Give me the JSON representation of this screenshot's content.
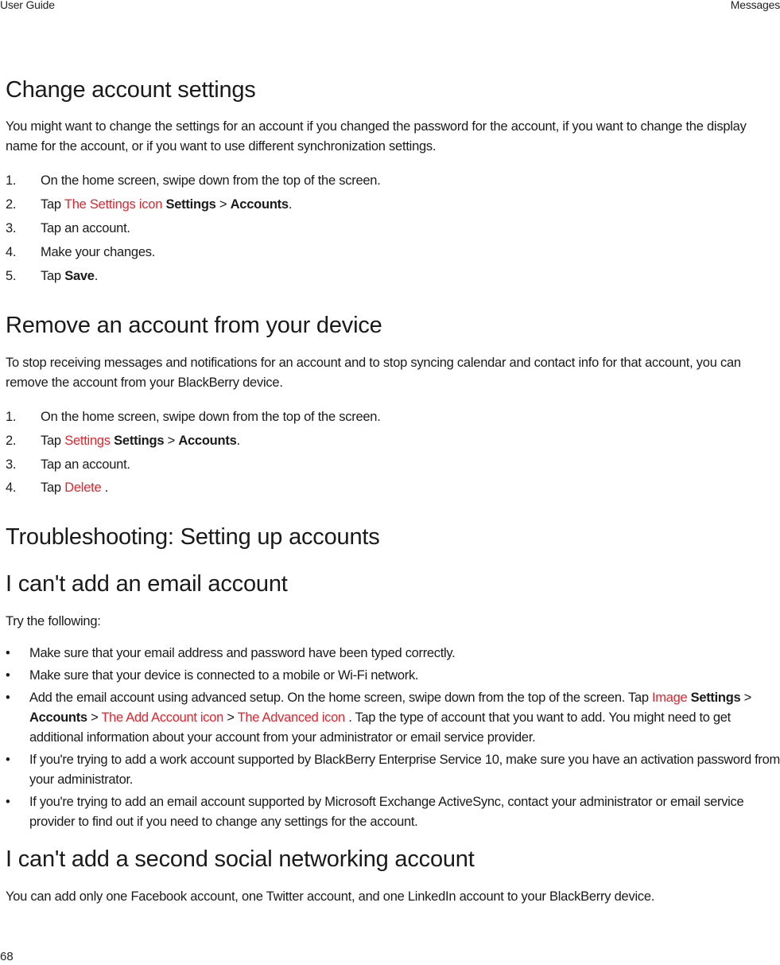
{
  "header": {
    "left": "User Guide",
    "right": "Messages"
  },
  "footer": {
    "page_number": "68"
  },
  "sections": {
    "change": {
      "title": "Change account settings",
      "intro": "You might want to change the settings for an account if you changed the password for the account, if you want to change the display name for the account, or if you want to use different synchronization settings.",
      "steps": [
        {
          "num": "1.",
          "text": "On the home screen, swipe down from the top of the screen."
        },
        {
          "num": "2.",
          "pre": "Tap ",
          "icon_alt": "The Settings icon",
          "b1": "Settings",
          "sep": " > ",
          "b2": "Accounts",
          "post": "."
        },
        {
          "num": "3.",
          "text": "Tap an account."
        },
        {
          "num": "4.",
          "text": "Make your changes."
        },
        {
          "num": "5.",
          "pre": "Tap ",
          "bold": "Save",
          "post": "."
        }
      ]
    },
    "remove": {
      "title": "Remove an account from your device",
      "intro": "To stop receiving messages and notifications for an account and to stop syncing calendar and contact info for that account, you can remove the account from your BlackBerry device.",
      "steps": [
        {
          "num": "1.",
          "text": "On the home screen, swipe down from the top of the screen."
        },
        {
          "num": "2.",
          "pre": "Tap ",
          "icon_alt": "Settings",
          "b1": "Settings",
          "sep": " > ",
          "b2": "Accounts",
          "post": "."
        },
        {
          "num": "3.",
          "text": "Tap an account."
        },
        {
          "num": "4.",
          "pre": "Tap ",
          "icon_alt": "Delete",
          "post": " ."
        }
      ]
    },
    "troubleshooting": {
      "title": "Troubleshooting: Setting up accounts"
    },
    "cant_add_email": {
      "title": "I can't add an email account",
      "intro": "Try the following:",
      "bullets": [
        {
          "text": "Make sure that your email address and password have been typed correctly."
        },
        {
          "text": "Make sure that your device is connected to a mobile or Wi-Fi network."
        },
        {
          "pre": "Add the email account using advanced setup. On the home screen, swipe down from the top of the screen. Tap ",
          "icon1": "Image",
          "b1": "Settings",
          "sep1": " > ",
          "b2": "Accounts",
          "sep2": " > ",
          "icon2": "The Add Account icon",
          "sep3": " > ",
          "icon3": "The Advanced icon",
          "post": ". Tap the type of account that you want to add. You might need to get additional information about your account from your administrator or email service provider."
        },
        {
          "text": "If you're trying to add a work account supported by BlackBerry Enterprise Service 10, make sure you have an activation password from your administrator."
        },
        {
          "text": "If you're trying to add an email account supported by Microsoft Exchange ActiveSync, contact your administrator or email service provider to find out if you need to change any settings for the account."
        }
      ]
    },
    "cant_add_social": {
      "title": "I can't add a second social networking account",
      "body": "You can add only one Facebook account, one Twitter account, and one LinkedIn account to your BlackBerry device."
    }
  },
  "bullet_char": "•"
}
